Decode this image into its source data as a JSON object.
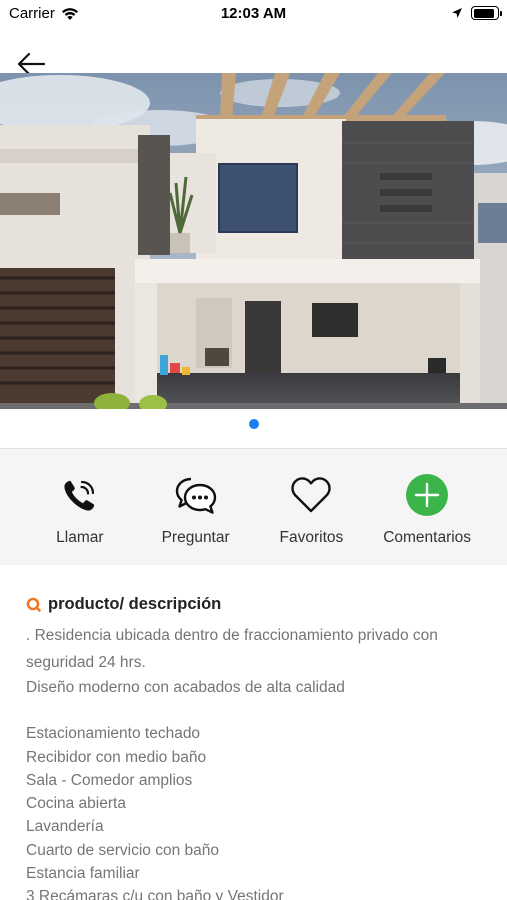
{
  "status_bar": {
    "carrier": "Carrier",
    "time": "12:03 AM",
    "battery_level": 0.9
  },
  "nav": {
    "back_icon": "arrow-left-icon"
  },
  "gallery": {
    "image_description": "house-photo",
    "page_count": 1,
    "active_page": 1,
    "dot_color": "#1a7cf0"
  },
  "actions": [
    {
      "id": "call",
      "label": "Llamar",
      "icon": "phone-icon"
    },
    {
      "id": "ask",
      "label": "Preguntar",
      "icon": "chat-bubbles-icon"
    },
    {
      "id": "favorites",
      "label": "Favoritos",
      "icon": "heart-icon"
    },
    {
      "id": "comments",
      "label": "Comentarios",
      "icon": "plus-circle-icon",
      "color": "#3bb54a"
    }
  ],
  "product": {
    "section_icon": "search-icon",
    "section_icon_color": "#f07820",
    "title": "producto/ descripción",
    "intro": ". Residencia ubicada dentro de fraccionamiento privado con seguridad 24 hrs.",
    "lines_a": [
      "Diseño moderno con acabados de alta calidad"
    ],
    "lines_b": [
      "Estacionamiento techado",
      "Recibidor con medio baño",
      "Sala - Comedor amplios",
      "Cocina abierta",
      "Lavandería",
      "Cuarto de servicio con baño",
      "Estancia familiar",
      "3 Recámaras c/u con baño y Vestidor"
    ]
  }
}
